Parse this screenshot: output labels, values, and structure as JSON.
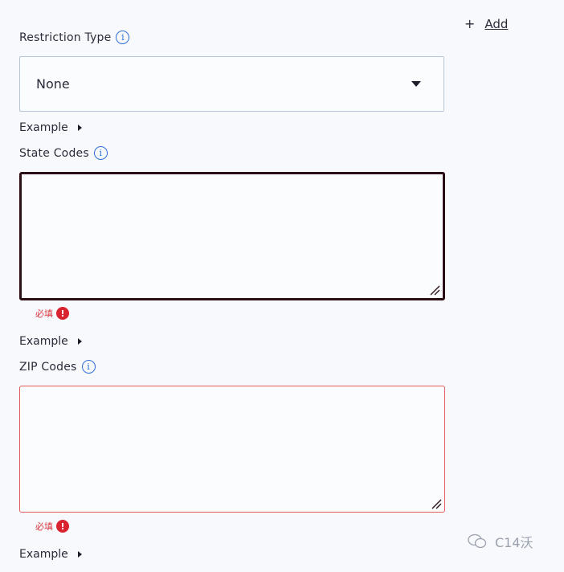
{
  "header": {
    "add_label": "Add",
    "add_symbol": "+"
  },
  "restriction_type": {
    "label": "Restriction Type",
    "selected": "None"
  },
  "state_codes": {
    "example_label": "Example",
    "label": "State Codes",
    "value": "",
    "error_text": "必填"
  },
  "zip_codes": {
    "example_label": "Example",
    "label": "ZIP Codes",
    "value": "",
    "error_text": "必填",
    "footer_example_label": "Example"
  },
  "error_badge": "!",
  "watermark": {
    "text": "C14沃"
  },
  "colors": {
    "info_blue": "#2e6fd8",
    "error_red": "#d9232e",
    "focus_border": "#2a0f16",
    "error_border": "#e25a5a"
  }
}
